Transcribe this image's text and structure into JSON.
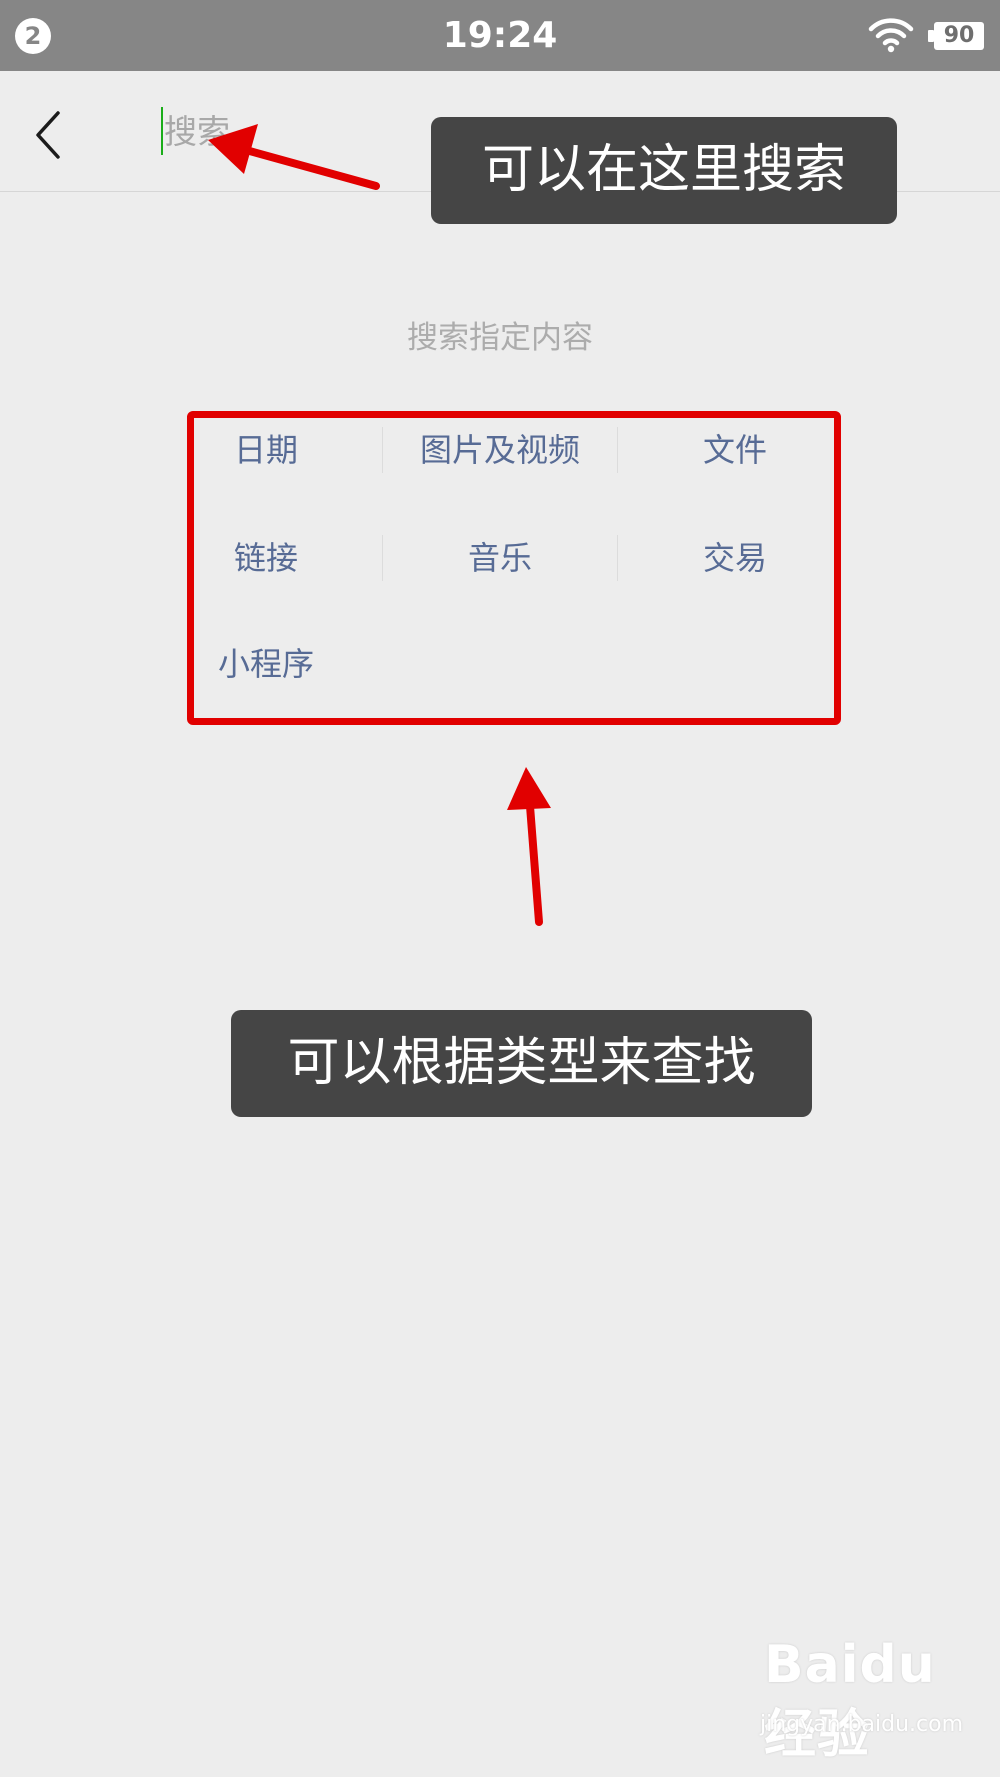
{
  "status_bar": {
    "notification_count": "2",
    "time": "19:24",
    "battery_level": "90",
    "icons": [
      "notification-badge",
      "wifi-icon",
      "battery-icon"
    ]
  },
  "search": {
    "placeholder": "搜索",
    "back_icon": "chevron-left-icon",
    "accent_color": "#1aad19"
  },
  "hint": "搜索指定内容",
  "categories": {
    "link_color": "#576b95",
    "items": [
      {
        "label": "日期"
      },
      {
        "label": "图片及视频"
      },
      {
        "label": "文件"
      },
      {
        "label": "链接"
      },
      {
        "label": "音乐"
      },
      {
        "label": "交易"
      },
      {
        "label": "小程序"
      }
    ]
  },
  "annotations": {
    "callout_search": "可以在这里搜索",
    "callout_types": "可以根据类型来查找",
    "highlight_color": "#e10000"
  },
  "watermark": {
    "logo": "Baidu经验",
    "url": "jingyan.baidu.com"
  }
}
